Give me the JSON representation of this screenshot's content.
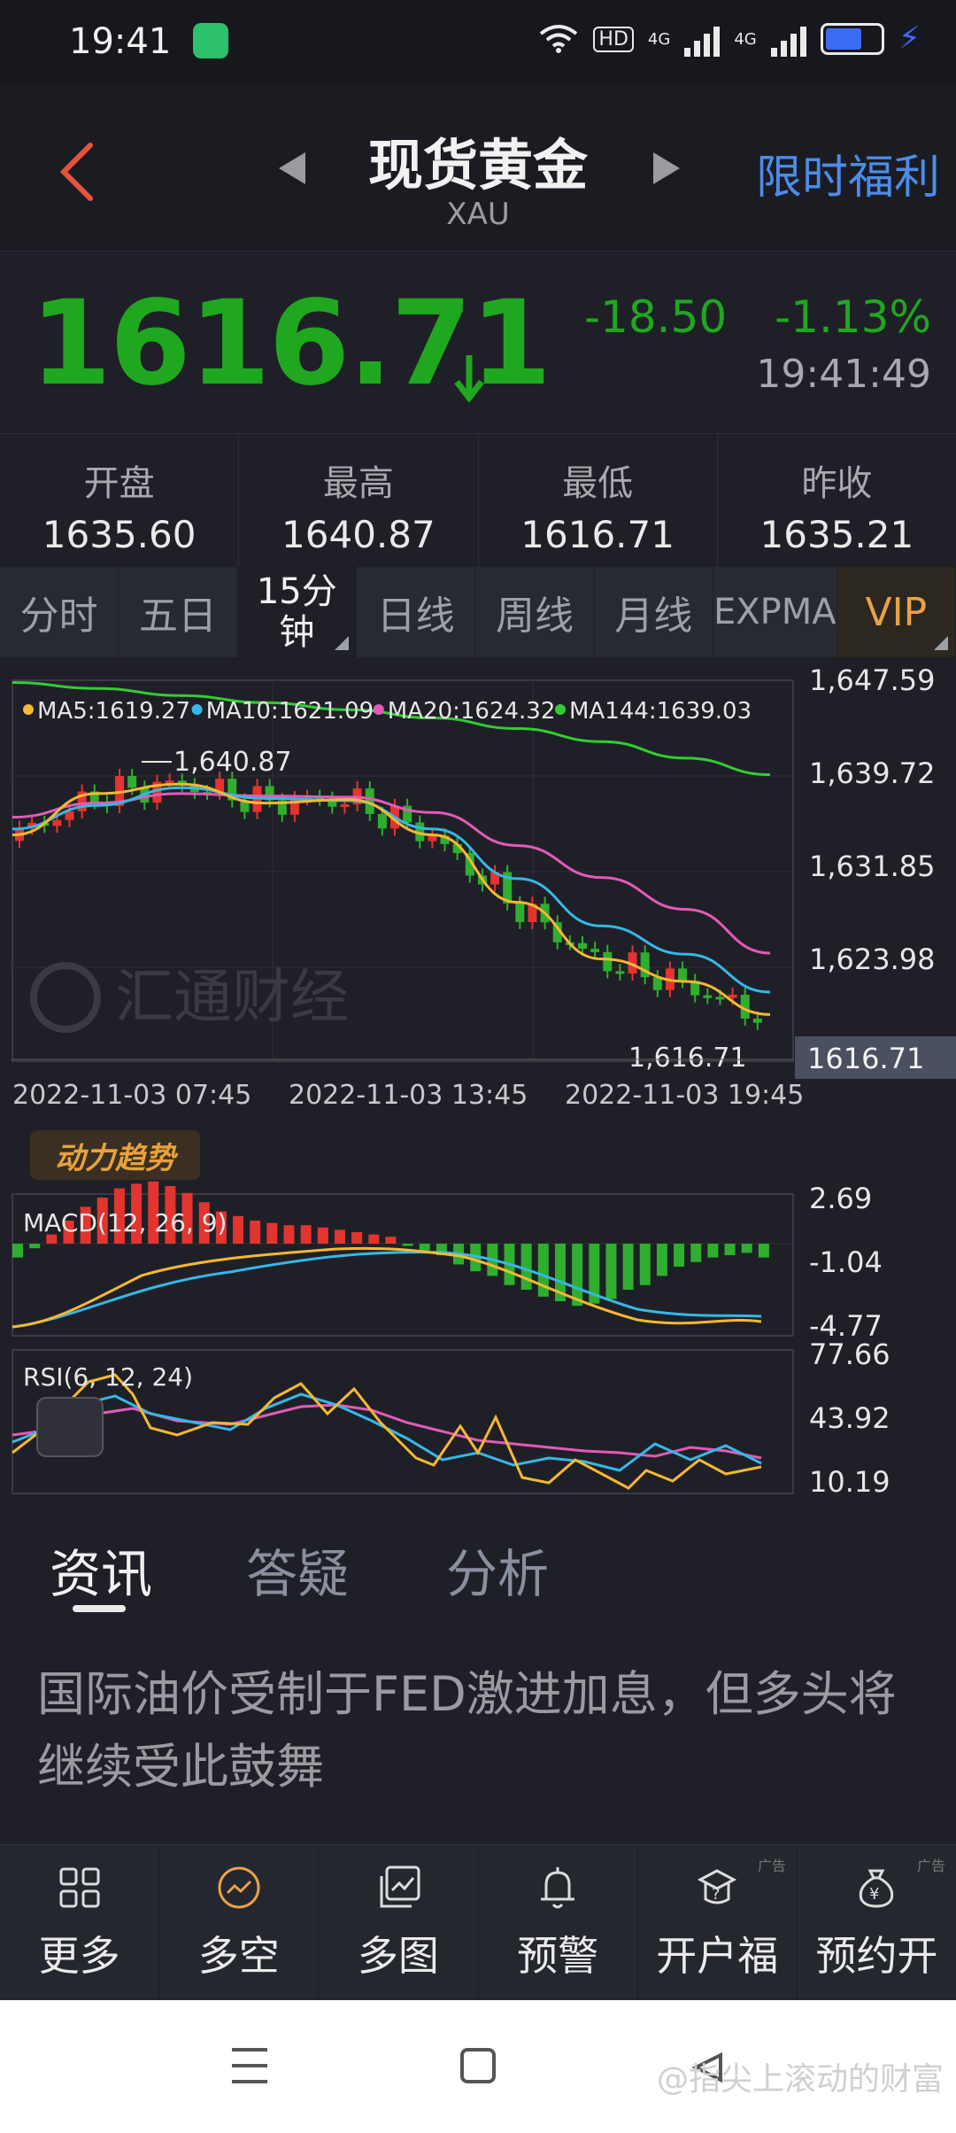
{
  "status": {
    "time": "19:41",
    "hd_label": "HD",
    "net1": "4G",
    "net2": "4G"
  },
  "header": {
    "title": "现货黄金",
    "symbol": "XAU",
    "promo": "限时福利"
  },
  "quote": {
    "price": "1616.71",
    "change": "-18.50",
    "change_pct": "-1.13%",
    "time": "19:41:49",
    "down_color": "#1fa81f"
  },
  "stats": [
    {
      "label": "开盘",
      "value": "1635.60"
    },
    {
      "label": "最高",
      "value": "1640.87"
    },
    {
      "label": "最低",
      "value": "1616.71"
    },
    {
      "label": "昨收",
      "value": "1635.21"
    }
  ],
  "tabs": [
    {
      "label": "分时"
    },
    {
      "label": "五日"
    },
    {
      "label_line1": "15分",
      "label_line2": "钟"
    },
    {
      "label": "日线"
    },
    {
      "label": "周线"
    },
    {
      "label": "月线"
    },
    {
      "label": "EXPMA"
    },
    {
      "label": "VIP"
    }
  ],
  "chart_data": [
    {
      "type": "line",
      "title": "",
      "legend": [
        {
          "name": "MA5:1619.27",
          "color": "#f5b833"
        },
        {
          "name": "MA10:1621.09",
          "color": "#35b8e8"
        },
        {
          "name": "MA20:1624.32",
          "color": "#e15ab7"
        },
        {
          "name": "MA144:1639.03",
          "color": "#33cc33"
        }
      ],
      "y_ticks": [
        "1,647.59",
        "1,639.72",
        "1,631.85",
        "1,623.98"
      ],
      "ylim": [
        1615.5,
        1647.59
      ],
      "x_ticks": [
        "2022-11-03 07:45",
        "2022-11-03 13:45",
        "2022-11-03 19:45"
      ],
      "annotations": {
        "high": "1,640.87",
        "low": "1,616.71"
      },
      "last_price_label": "1616.71",
      "series": [
        {
          "name": "MA144",
          "color": "#33cc33",
          "values": [
            1647.4,
            1646.9,
            1646.3,
            1645.7,
            1645.1,
            1644.4,
            1643.5,
            1642.4,
            1641.0,
            1639.6
          ]
        },
        {
          "name": "MA20",
          "color": "#e15ab7",
          "values": [
            1636.0,
            1637.2,
            1638.0,
            1637.8,
            1637.7,
            1636.4,
            1633.6,
            1630.9,
            1628.2,
            1624.5
          ]
        },
        {
          "name": "MA10",
          "color": "#35b8e8",
          "values": [
            1635.0,
            1637.0,
            1638.5,
            1637.6,
            1637.4,
            1635.0,
            1630.8,
            1626.8,
            1624.4,
            1621.2
          ]
        },
        {
          "name": "MA5",
          "color": "#f5b833",
          "values": [
            1634.5,
            1638.0,
            1638.8,
            1637.2,
            1637.5,
            1634.5,
            1628.8,
            1624.0,
            1622.1,
            1619.3
          ]
        }
      ]
    },
    {
      "type": "bar",
      "title": "MACD(12, 26, 9)",
      "y_ticks": [
        "2.69",
        "-1.04",
        "-4.77"
      ],
      "values": [
        -0.6,
        -0.2,
        0.4,
        1.0,
        1.6,
        2.0,
        2.4,
        2.6,
        2.7,
        2.5,
        2.2,
        1.8,
        1.4,
        1.2,
        1.0,
        0.9,
        0.8,
        0.8,
        0.7,
        0.6,
        0.5,
        0.4,
        0.3,
        -0.1,
        -0.3,
        -0.5,
        -0.9,
        -1.2,
        -1.4,
        -1.8,
        -2.0,
        -2.3,
        -2.5,
        -2.7,
        -2.6,
        -2.4,
        -2.0,
        -1.8,
        -1.4,
        -1.0,
        -0.8,
        -0.6,
        -0.5,
        -0.4,
        -0.6
      ]
    },
    {
      "type": "line",
      "title": "RSI(6, 12, 24)",
      "y_ticks": [
        "77.66",
        "43.92",
        "10.19"
      ]
    }
  ],
  "indicator_badge": "动力趋势",
  "watermark_logo": "汇通财经",
  "news": {
    "tabs": [
      "资讯",
      "答疑",
      "分析"
    ],
    "headline": "国际油价受制于FED激进加息，但多头将继续受此鼓舞"
  },
  "bottom_bar": [
    {
      "label": "更多",
      "icon": "grid-icon"
    },
    {
      "label": "多空",
      "icon": "trend-icon"
    },
    {
      "label": "多图",
      "icon": "multi-chart-icon"
    },
    {
      "label": "预警",
      "icon": "bell-icon"
    },
    {
      "label": "开户福",
      "icon": "gift-icon",
      "ad": "广告"
    },
    {
      "label": "预约开",
      "icon": "money-icon",
      "ad": "广告"
    }
  ],
  "system_nav": {
    "watermark": "@指尖上滚动的财富"
  }
}
